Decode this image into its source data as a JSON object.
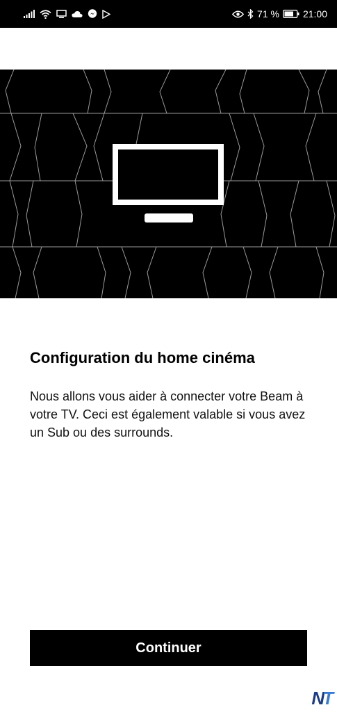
{
  "status_bar": {
    "battery": "71 %",
    "time": "21:00",
    "left_icons": [
      "signal-icon",
      "wifi-icon",
      "screen-cast-icon",
      "cloud-icon",
      "messenger-icon",
      "play-store-icon"
    ],
    "right_icons": [
      "eye-icon",
      "bluetooth-icon",
      "battery-icon"
    ]
  },
  "hero": {
    "icon": "tv-icon",
    "background": "#000000"
  },
  "content": {
    "title": "Configuration du home cinéma",
    "description": "Nous allons vous aider à connecter votre Beam à votre TV. Ceci est également valable si vous avez un Sub ou des surrounds."
  },
  "actions": {
    "continue_label": "Continuer"
  },
  "watermark": {
    "part1": "N",
    "part2": "T",
    "color1": "#1a3a8a",
    "color2": "#3a7bd5"
  }
}
